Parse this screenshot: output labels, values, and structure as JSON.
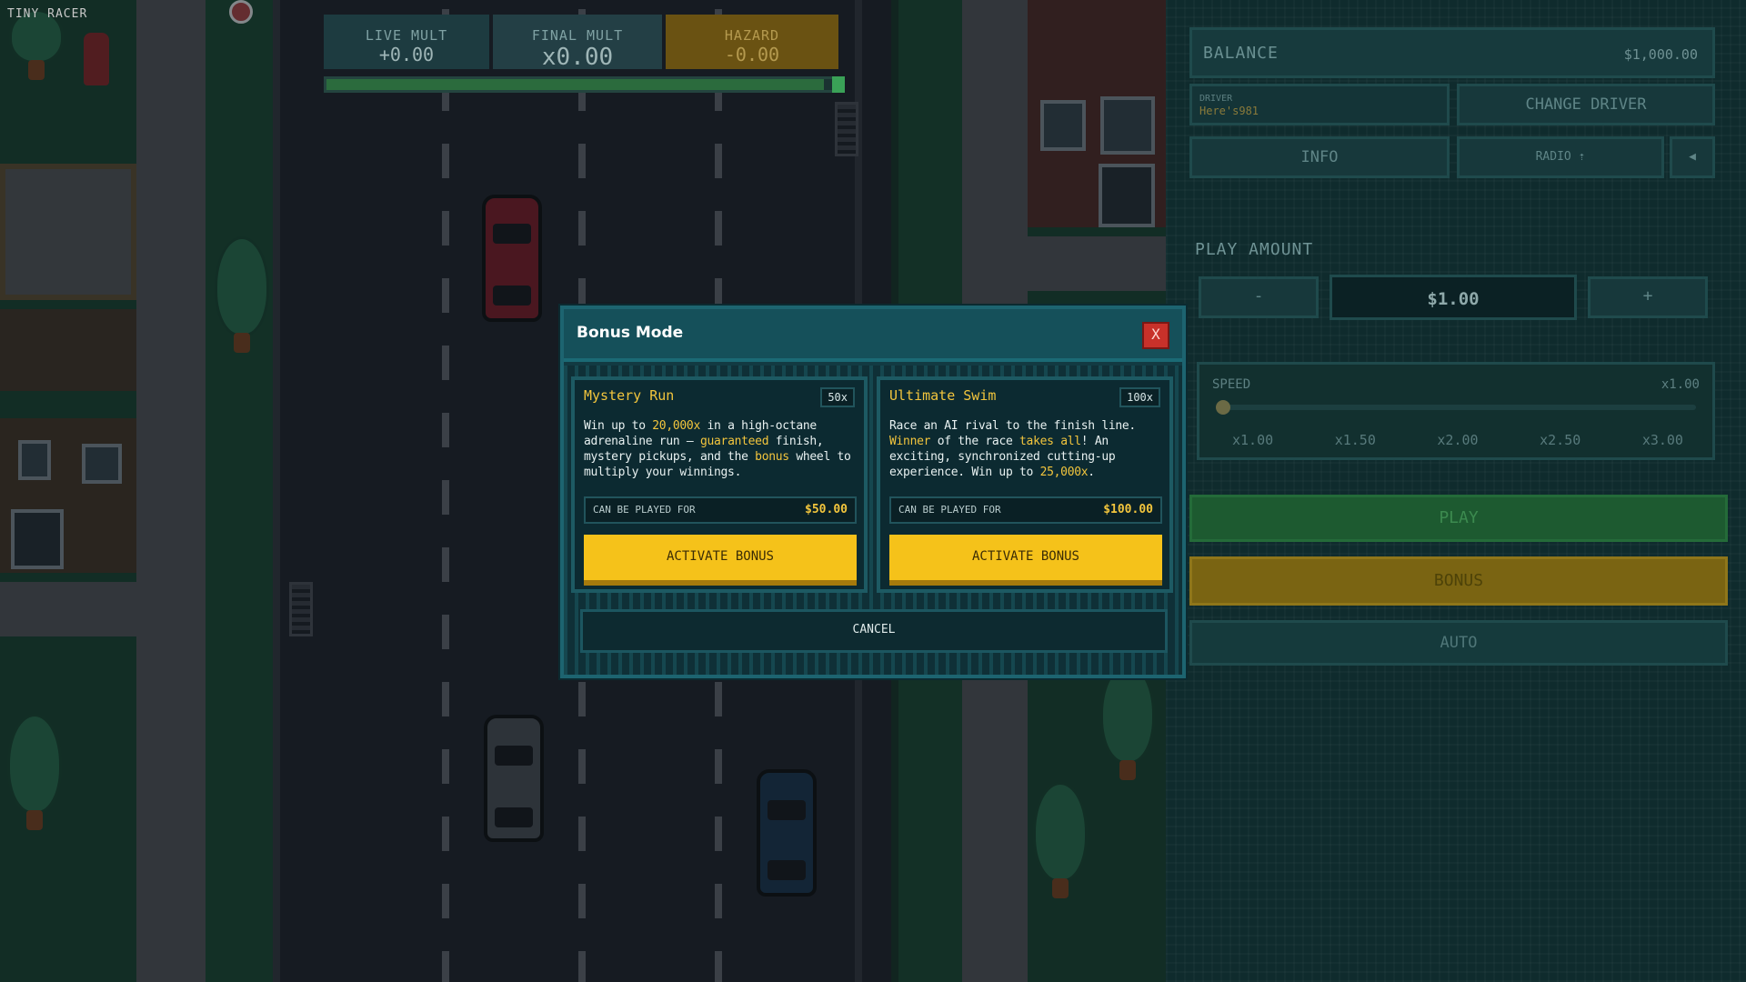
{
  "game": {
    "title": "TINY RACER"
  },
  "hud": {
    "live_mult_label": "LIVE MULT",
    "live_mult_value": "+0.00",
    "final_mult_label": "FINAL MULT",
    "final_mult_value": "x0.00",
    "hazard_label": "HAZARD",
    "hazard_value": "-0.00"
  },
  "panel": {
    "balance_label": "BALANCE",
    "balance_value": "$1,000.00",
    "driver_label": "DRIVER",
    "driver_name": "Here's981",
    "change_driver": "CHANGE DRIVER",
    "info": "INFO",
    "radio": "RADIO ⇡",
    "sound_icon": "speaker-icon",
    "play_amount_label": "PLAY AMOUNT",
    "minus": "-",
    "amount": "$1.00",
    "plus": "+",
    "speed_label": "SPEED",
    "speed_value": "x1.00",
    "speed_options": [
      "x1.00",
      "x1.50",
      "x2.00",
      "x2.50",
      "x3.00"
    ],
    "play": "PLAY",
    "bonus": "BONUS",
    "auto": "AUTO"
  },
  "modal": {
    "title": "Bonus Mode",
    "close": "X",
    "cancel": "CANCEL",
    "cards": [
      {
        "title": "Mystery Run",
        "badge": "50x",
        "desc_parts": [
          {
            "t": "Win up to ",
            "h": false
          },
          {
            "t": "20,000x",
            "h": true
          },
          {
            "t": " in a high-octane adrenaline run — ",
            "h": false
          },
          {
            "t": "guaranteed",
            "h": true
          },
          {
            "t": " finish, mystery pickups, and the ",
            "h": false
          },
          {
            "t": "bonus",
            "h": true
          },
          {
            "t": " wheel to multiply your winnings.",
            "h": false
          }
        ],
        "price_label": "CAN BE PLAYED FOR",
        "price_value": "$50.00",
        "button": "ACTIVATE BONUS"
      },
      {
        "title": "Ultimate Swim",
        "badge": "100x",
        "desc_parts": [
          {
            "t": "Race an AI rival to the finish line. ",
            "h": false
          },
          {
            "t": "Winner",
            "h": true
          },
          {
            "t": " of the race ",
            "h": false
          },
          {
            "t": "takes all",
            "h": true
          },
          {
            "t": "! An exciting, synchronized cutting-up experience. Win up to ",
            "h": false
          },
          {
            "t": "25,000x",
            "h": true
          },
          {
            "t": ".",
            "h": false
          }
        ],
        "price_label": "CAN BE PLAYED FOR",
        "price_value": "$100.00",
        "button": "ACTIVATE BONUS"
      }
    ]
  },
  "colors": {
    "accent_yellow": "#f5c21a",
    "highlight_text": "#f2c53d",
    "close_red": "#c8312a",
    "play_green": "#1d5a30",
    "modal_bg": "#123a42"
  },
  "progress": {
    "fraction": 0.97
  }
}
